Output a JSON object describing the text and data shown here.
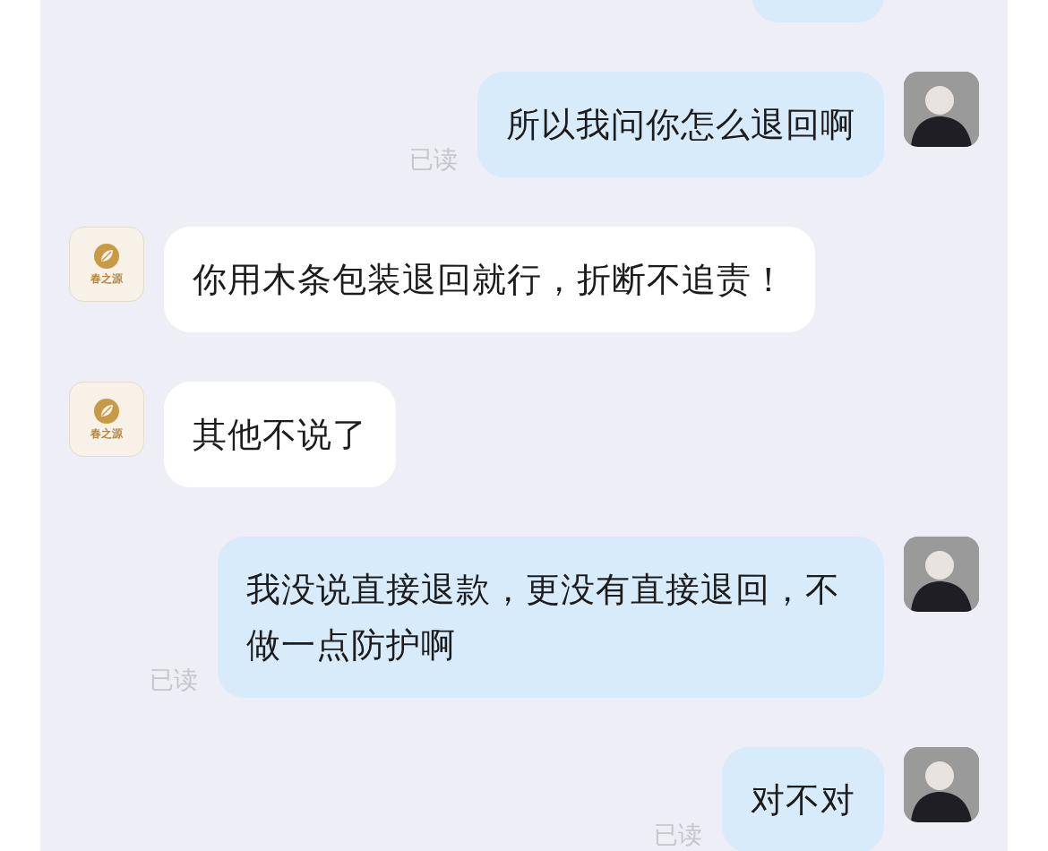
{
  "messages": [
    {
      "kind": "sent_cut"
    },
    {
      "kind": "sent",
      "text": "所以我问你怎么退回啊",
      "read": "已读"
    },
    {
      "kind": "received",
      "text": "你用木条包装退回就行，折断不追责！",
      "logo": "春之源"
    },
    {
      "kind": "received",
      "text": "其他不说了",
      "logo": "春之源"
    },
    {
      "kind": "sent",
      "text": "我没说直接退款，更没有直接退回，不做一点防护啊",
      "read": "已读"
    },
    {
      "kind": "sent",
      "text": "对不对",
      "read": "已读"
    }
  ]
}
